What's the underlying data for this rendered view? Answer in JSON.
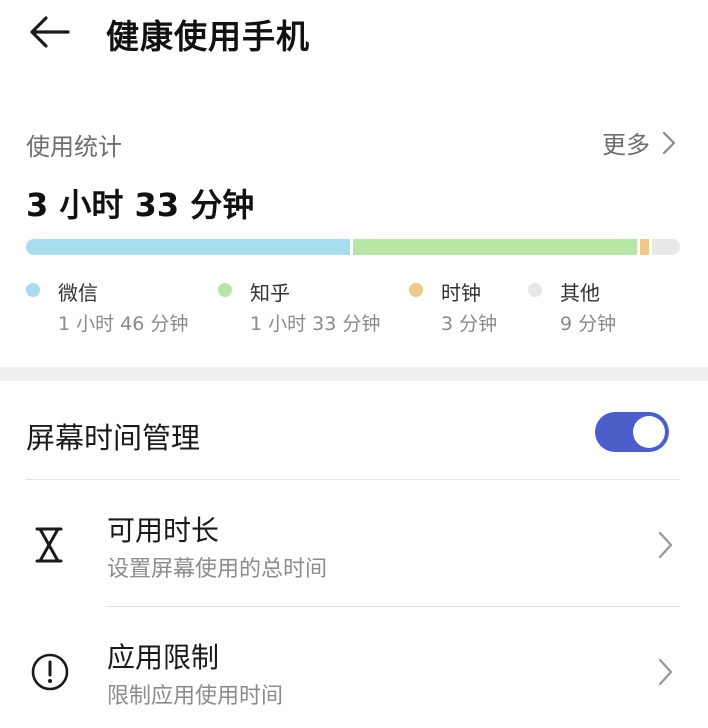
{
  "header": {
    "title": "健康使用手机",
    "back_icon": "arrow-left-icon"
  },
  "usage": {
    "section_label": "使用统计",
    "more_label": "更多",
    "total": "3 小时 33 分钟",
    "apps": [
      {
        "name": "微信",
        "time": "1 小时 46 分钟",
        "minutes": 106,
        "color": "#a9dbf1"
      },
      {
        "name": "知乎",
        "time": "1 小时 33 分钟",
        "minutes": 93,
        "color": "#b6e6a6"
      },
      {
        "name": "时钟",
        "time": "3 分钟",
        "minutes": 3,
        "color": "#f0c98a"
      },
      {
        "name": "其他",
        "time": "9 分钟",
        "minutes": 9,
        "color": "#e8e8e8"
      }
    ]
  },
  "settings": {
    "screen_time_label": "屏幕时间管理",
    "screen_time_enabled": true,
    "toggle_color": "#4b5ec9",
    "items": [
      {
        "title": "可用时长",
        "subtitle": "设置屏幕使用的总时间",
        "icon": "hourglass-icon"
      },
      {
        "title": "应用限制",
        "subtitle": "限制应用使用时间",
        "icon": "alert-circle-icon"
      }
    ]
  }
}
